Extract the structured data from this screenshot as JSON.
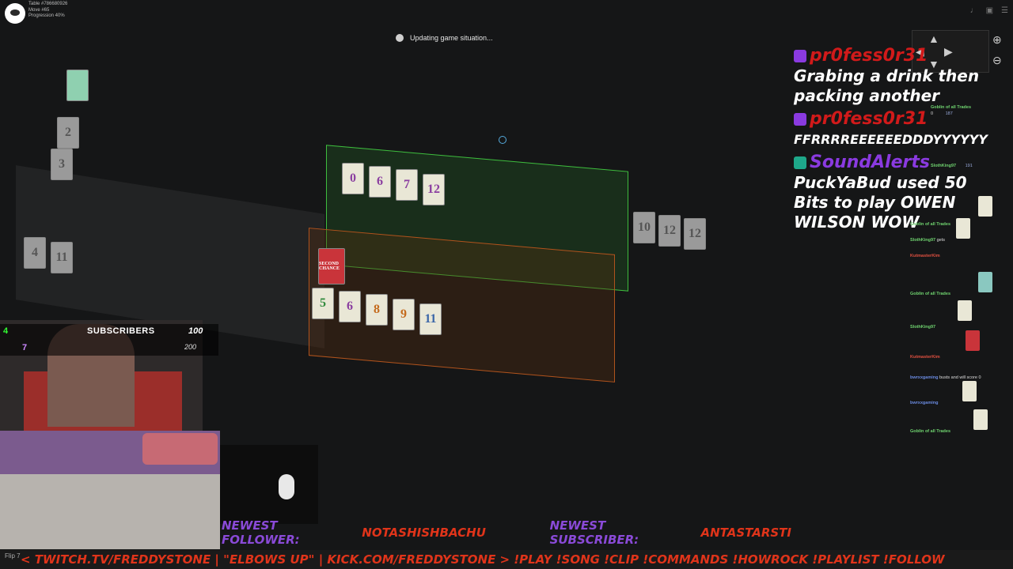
{
  "table_info": {
    "table": "Table #786680926",
    "move": "Move #65",
    "progression": "Progression 40%"
  },
  "status": {
    "text": "Updating game situation..."
  },
  "board": {
    "top_left_cards": [
      "2",
      "3"
    ],
    "left_tray_cards": [
      "4",
      "11"
    ],
    "green_player_cards": [
      "0",
      "6",
      "7",
      "12"
    ],
    "orange_player_top_card": "SECOND CHANCE",
    "orange_player_cards": [
      "5",
      "6",
      "8",
      "9",
      "11"
    ],
    "right_deck_cards": [
      "10",
      "12",
      "12"
    ]
  },
  "chat_overlay": [
    {
      "user": "pr0fess0r31",
      "text": "Grabing a drink then packing another"
    },
    {
      "user": "pr0fess0r31",
      "text": "FFRRRREEEEEEDDDYYYYYY"
    },
    {
      "user": "SoundAlerts",
      "text": "PuckYaBud used 50 Bits to play OWEN WILSON WOW"
    }
  ],
  "game_log": {
    "player": "Goblin of all Trades",
    "score_display": "0",
    "points": "187",
    "entries": [
      {
        "name": "SlothKing97",
        "text": "191",
        "color": "green"
      },
      {
        "name": "Goblin of all Trades",
        "text": "",
        "color": "green"
      },
      {
        "name": "SlothKing97",
        "text": "gets",
        "color": "green"
      },
      {
        "name": "KutmasterKim",
        "text": "",
        "color": "red"
      },
      {
        "name": "Goblin of all Trades",
        "text": "",
        "color": "green"
      },
      {
        "name": "SlothKing97",
        "text": "",
        "color": "green"
      },
      {
        "name": "KutmasterKim",
        "text": "",
        "color": "red"
      },
      {
        "name": "bwrxxgaming",
        "text": "busts and will score 0",
        "color": "blue"
      },
      {
        "name": "bwrxxgaming",
        "text": "",
        "color": "blue"
      },
      {
        "name": "Goblin of all Trades",
        "text": "",
        "color": "green"
      }
    ]
  },
  "subscribers": {
    "title": "SUBSCRIBERS",
    "count1": "100",
    "count2": "200",
    "left_numbers": [
      "4",
      "7"
    ]
  },
  "banners": {
    "follower_label": "NEWEST FOLLOWER:",
    "follower_value": "NOTASHISHBACHU",
    "subscriber_label": "NEWEST SUBSCRIBER:",
    "subscriber_value": "ANTASTARSTI"
  },
  "ticker": {
    "text": "< TWITCH.TV/FREDDYSTONE | \"ELBOWS UP\" | KICK.COM/FREDDYSTONE > !PLAY !SONG !CLIP !COMMANDS !HOWROCK !PLAYLIST !FOLLOW"
  },
  "flip_label": "Flip 7"
}
